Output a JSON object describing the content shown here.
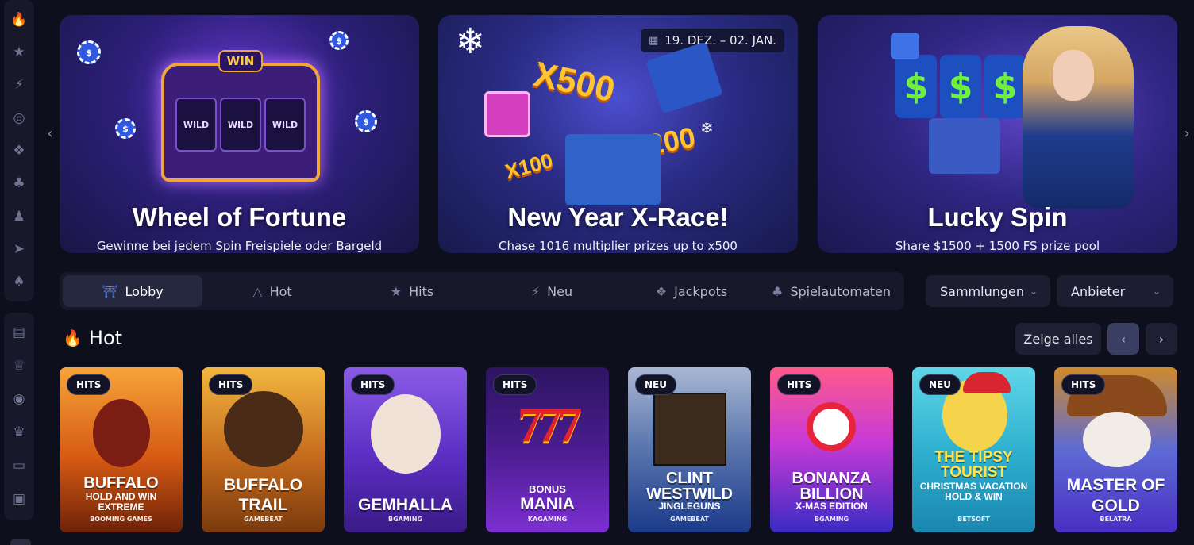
{
  "sidebar": {
    "top_icons": [
      "flame-icon",
      "star-icon",
      "lightning-icon",
      "target-icon",
      "jackpot-icon",
      "cherries-icon",
      "chess-icon",
      "rocket-icon",
      "card-icon"
    ],
    "bottom_icons": [
      "gift-icon",
      "trophy-icon",
      "slot-777-icon",
      "crown-icon",
      "credit-card-icon",
      "wallet-icon"
    ]
  },
  "banners": [
    {
      "title": "Wheel of Fortune",
      "subtitle": "Gewinne bei jedem Spin Freispiele oder Bargeld",
      "art_win": "WIN",
      "art_reel": "WILD"
    },
    {
      "title": "New Year X-Race!",
      "subtitle": "Chase 1016 multiplier prizes up to x500",
      "date": "19. DEZ. – 02. JAN.",
      "art_x500": "X500",
      "art_x200": "X200",
      "art_x100": "X100"
    },
    {
      "title": "Lucky Spin",
      "subtitle": "Share $1500 + 1500 FS prize pool",
      "art_reel": "$"
    }
  ],
  "nav": {
    "tabs": [
      {
        "label": "Lobby",
        "icon": "lobby-icon",
        "active": true
      },
      {
        "label": "Hot",
        "icon": "flame-icon",
        "active": false
      },
      {
        "label": "Hits",
        "icon": "star-icon",
        "active": false
      },
      {
        "label": "Neu",
        "icon": "lightning-icon",
        "active": false
      },
      {
        "label": "Jackpots",
        "icon": "jackpot-icon",
        "active": false
      },
      {
        "label": "Spielautomaten",
        "icon": "cherries-icon",
        "active": false
      }
    ],
    "collections_label": "Sammlungen",
    "providers_label": "Anbieter"
  },
  "section": {
    "title": "Hot",
    "show_all": "Zeige alles"
  },
  "games": [
    {
      "badge": "HITS",
      "name": "BUFFALO",
      "sub": "HOLD AND WIN EXTREME",
      "provider": "BOOMING GAMES"
    },
    {
      "badge": "HITS",
      "name": "BUFFALO TRAIL",
      "sub": "",
      "provider": "GAMEBEAT"
    },
    {
      "badge": "HITS",
      "name": "GEMHALLA",
      "sub": "",
      "provider": "BGAMING"
    },
    {
      "badge": "HITS",
      "name": "MANIA",
      "sub": "BONUS",
      "provider": "KAGAMING"
    },
    {
      "badge": "NEU",
      "name": "CLINT WESTWILD",
      "sub": "JINGLEGUNS",
      "provider": "GAMEBEAT"
    },
    {
      "badge": "HITS",
      "name": "BONANZA BILLION",
      "sub": "X-MAS EDITION",
      "provider": "BGAMING"
    },
    {
      "badge": "NEU",
      "name": "THE TIPSY TOURIST",
      "sub": "CHRISTMAS VACATION HOLD & WIN",
      "provider": "BETSOFT"
    },
    {
      "badge": "HITS",
      "name": "MASTER OF GOLD",
      "sub": "",
      "provider": "BELATRA"
    }
  ],
  "colors": {
    "background": "#0e0f1c",
    "panel": "#171829",
    "accent": "#5b8cff"
  }
}
